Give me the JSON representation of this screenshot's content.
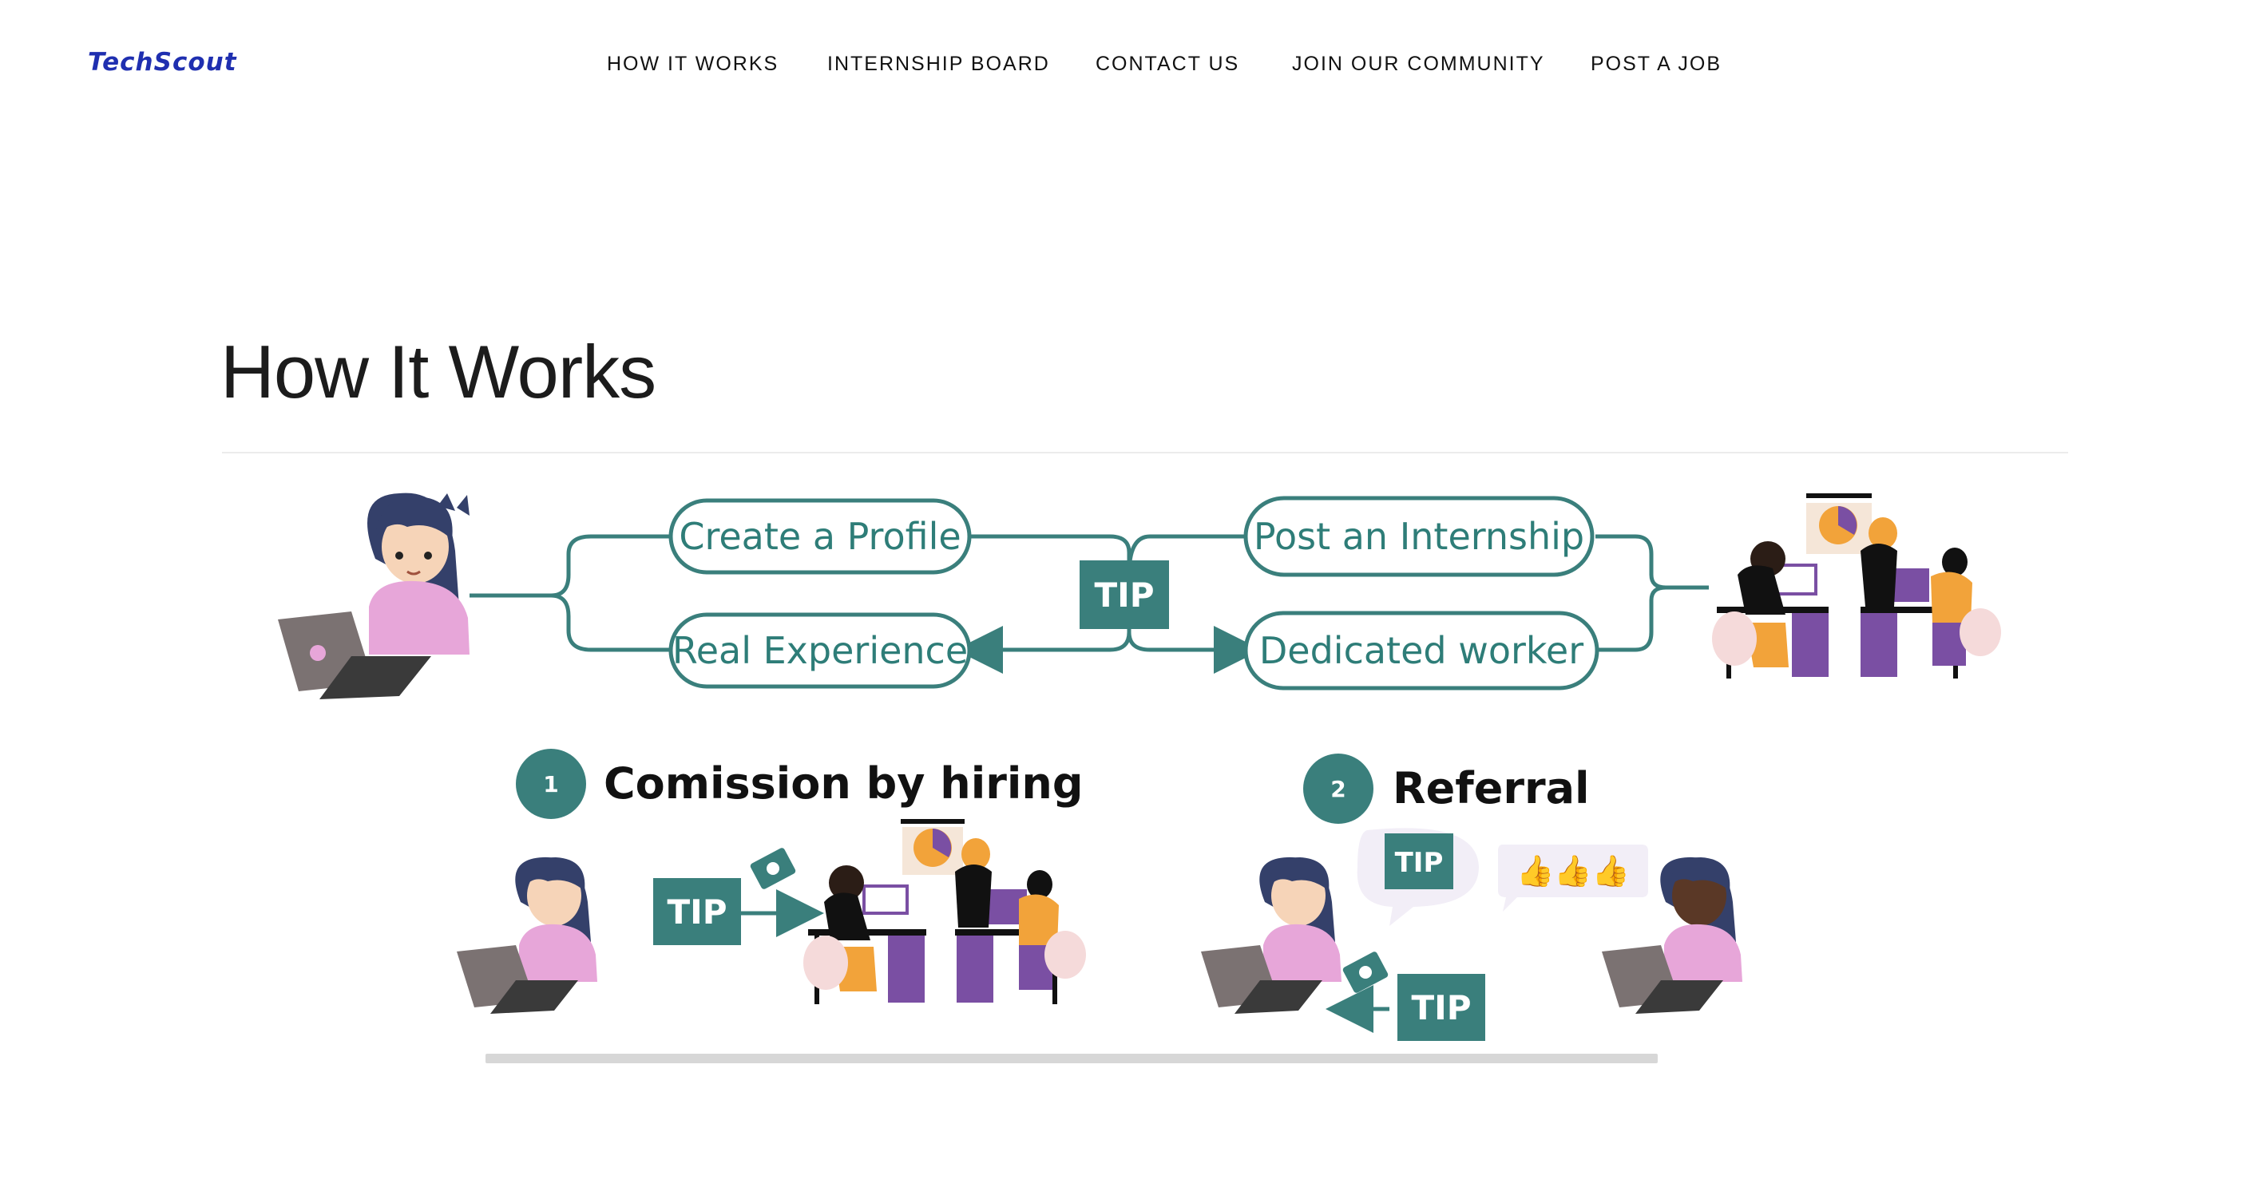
{
  "brand": {
    "logo_text": "TechScout"
  },
  "nav": {
    "items": [
      {
        "label": "HOW IT WORKS"
      },
      {
        "label": "INTERNSHIP BOARD"
      },
      {
        "label": "CONTACT US"
      },
      {
        "label": "JOIN OUR COMMUNITY"
      },
      {
        "label": "POST A JOB"
      }
    ]
  },
  "page": {
    "title": "How It Works"
  },
  "diagram": {
    "pills": {
      "create_profile": "Create a Profile",
      "real_experience": "Real Experience",
      "post_internship": "Post an Internship",
      "dedicated_worker": "Dedicated worker"
    },
    "tip_label": "TIP",
    "steps": [
      {
        "number": "1",
        "title": "Comission by hiring"
      },
      {
        "number": "2",
        "title": "Referral"
      }
    ],
    "thumbs": "👍👍👍"
  },
  "colors": {
    "teal": "#3a7f7c",
    "logo": "#1f2fb0",
    "orange": "#f2a33a",
    "purple": "#7a4fa3",
    "pink": "#e7a6d9",
    "hair": "#34406a"
  }
}
